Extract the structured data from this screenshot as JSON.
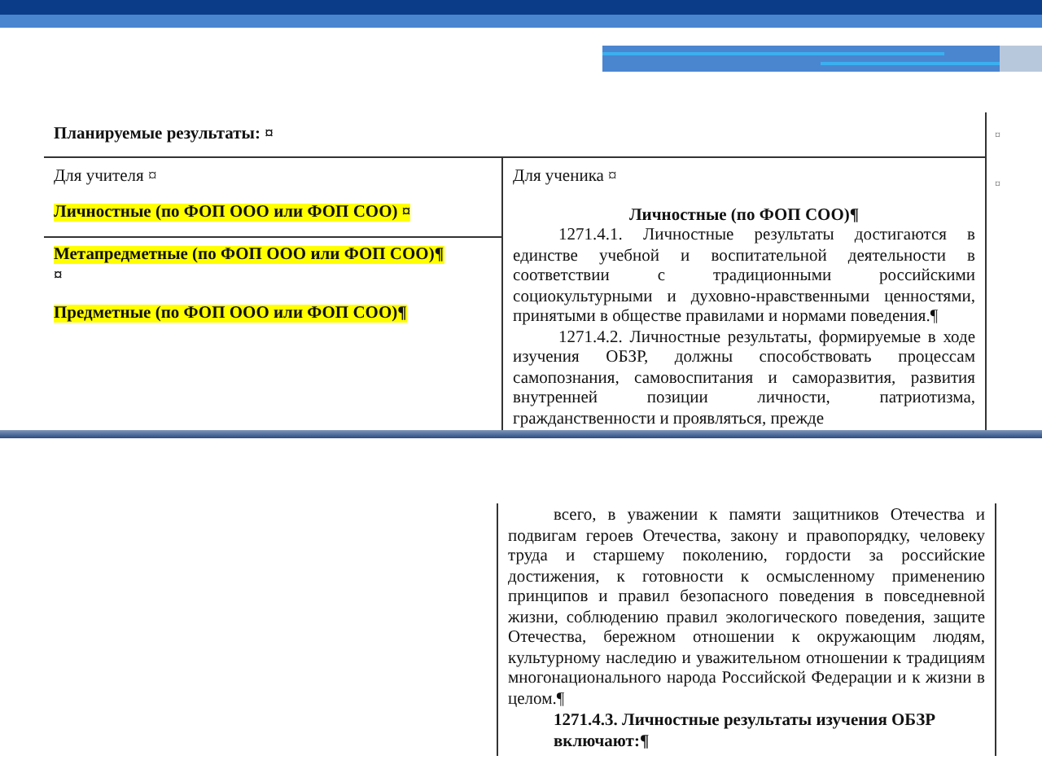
{
  "table": {
    "heading": "Планируемые результаты: ¤",
    "end_marks": [
      "¤",
      "¤"
    ],
    "teacher": {
      "label": "Для учителя ¤",
      "items": [
        {
          "text": "Личностные (по ФОП ООО или ФОП СОО) ¤",
          "highlighted": true
        },
        {
          "text": "Метапредметные (по ФОП ООО или ФОП СОО)¶",
          "highlighted": true
        },
        {
          "text": "¤",
          "highlighted": false
        },
        {
          "text": "Предметные (по ФОП ООО или ФОП СОО)¶",
          "highlighted": true
        }
      ]
    },
    "student": {
      "label": "Для ученика ¤",
      "heading": "Личностные (по ФОП СОО)¶",
      "paragraphs": [
        "1271.4.1. Личностные результаты достигаются в единстве учебной и воспитательной деятельности в соответствии с традиционными российскими социокультурными и духовно-нравственными ценностями, принятыми в обществе правилами и нормами поведения.¶",
        "1271.4.2. Личностные результаты, формируемые в ходе изучения ОБЗР, должны способствовать процессам самопознания, самовоспитания и саморазвития, развития внутренней позиции личности, патриотизма, гражданственности и проявляться, прежде"
      ]
    }
  },
  "continuation": {
    "paragraphs": [
      "всего, в уважении к памяти защитников Отечества и подвигам героев Отечества, закону и правопорядку, человеку труда и старшему поколению, гордости за российские достижения, к готовности к осмысленному применению принципов и правил безопасного поведения в повседневной жизни, соблюдению правил экологического поведения, защите Отечества, бережном отношении к окружающим людям, культурному наследию и уважительном отношении к традициям многонационального народа Российской Федерации и к жизни в целом.¶"
    ],
    "heading": "1271.4.3. Личностные результаты изучения ОБЗР включают:¶"
  }
}
